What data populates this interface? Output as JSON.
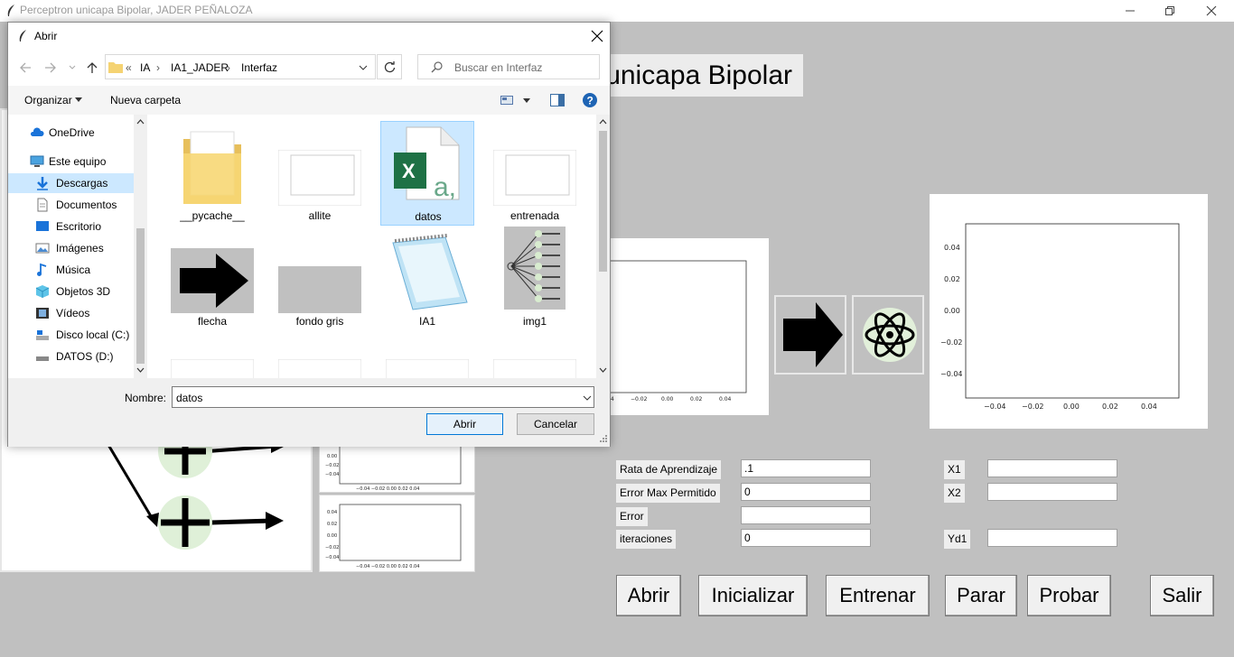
{
  "window": {
    "title": "Perceptron unicapa Bipolar, JADER PEÑALOZA",
    "heading": "Perceptron unicapa Bipolar"
  },
  "form": {
    "labels": {
      "rate": "Rata de Aprendizaje",
      "max_error": "Error Max Permitido",
      "error": "Error",
      "iterations": "iteraciones",
      "x1": "X1",
      "x2": "X2",
      "yd1": "Yd1"
    },
    "values": {
      "rate": ".1",
      "max_error": "0",
      "error": "",
      "iterations": "0",
      "x1": "",
      "x2": "",
      "yd1": ""
    }
  },
  "buttons": {
    "abrir": "Abrir",
    "inicializar": "Inicializar",
    "entrenar": "Entrenar",
    "parar": "Parar",
    "probar": "Probar",
    "salir": "Salir"
  },
  "plot_ticks": {
    "x": [
      "−0.04",
      "−0.02",
      "0.00",
      "0.02",
      "0.04"
    ],
    "y": [
      "0.04",
      "0.02",
      "0.00",
      "−0.02",
      "−0.04"
    ]
  },
  "dialog": {
    "title": "Abrir",
    "breadcrumb": [
      "«",
      "IA",
      "IA1_JADER",
      "Interfaz"
    ],
    "search_placeholder": "Buscar en Interfaz",
    "organize": "Organizar",
    "new_folder": "Nueva carpeta",
    "nav": [
      {
        "label": "OneDrive",
        "icon": "cloud-icon"
      },
      {
        "label": "Este equipo",
        "icon": "computer-icon"
      },
      {
        "label": "Descargas",
        "icon": "download-icon"
      },
      {
        "label": "Documentos",
        "icon": "document-icon"
      },
      {
        "label": "Escritorio",
        "icon": "desktop-icon"
      },
      {
        "label": "Imágenes",
        "icon": "images-icon"
      },
      {
        "label": "Música",
        "icon": "music-icon"
      },
      {
        "label": "Objetos 3D",
        "icon": "cube-icon"
      },
      {
        "label": "Vídeos",
        "icon": "video-icon"
      },
      {
        "label": "Disco local (C:)",
        "icon": "drive-icon"
      },
      {
        "label": "DATOS (D:)",
        "icon": "drive-icon"
      }
    ],
    "selected_nav": "Descargas",
    "files": [
      "__pycache__",
      "allite",
      "datos",
      "entrenada",
      "flecha",
      "fondo gris",
      "IA1",
      "img1"
    ],
    "selected_file": "datos",
    "filename_label": "Nombre:",
    "filename_value": "datos",
    "open_button": "Abrir",
    "cancel_button": "Cancelar"
  }
}
